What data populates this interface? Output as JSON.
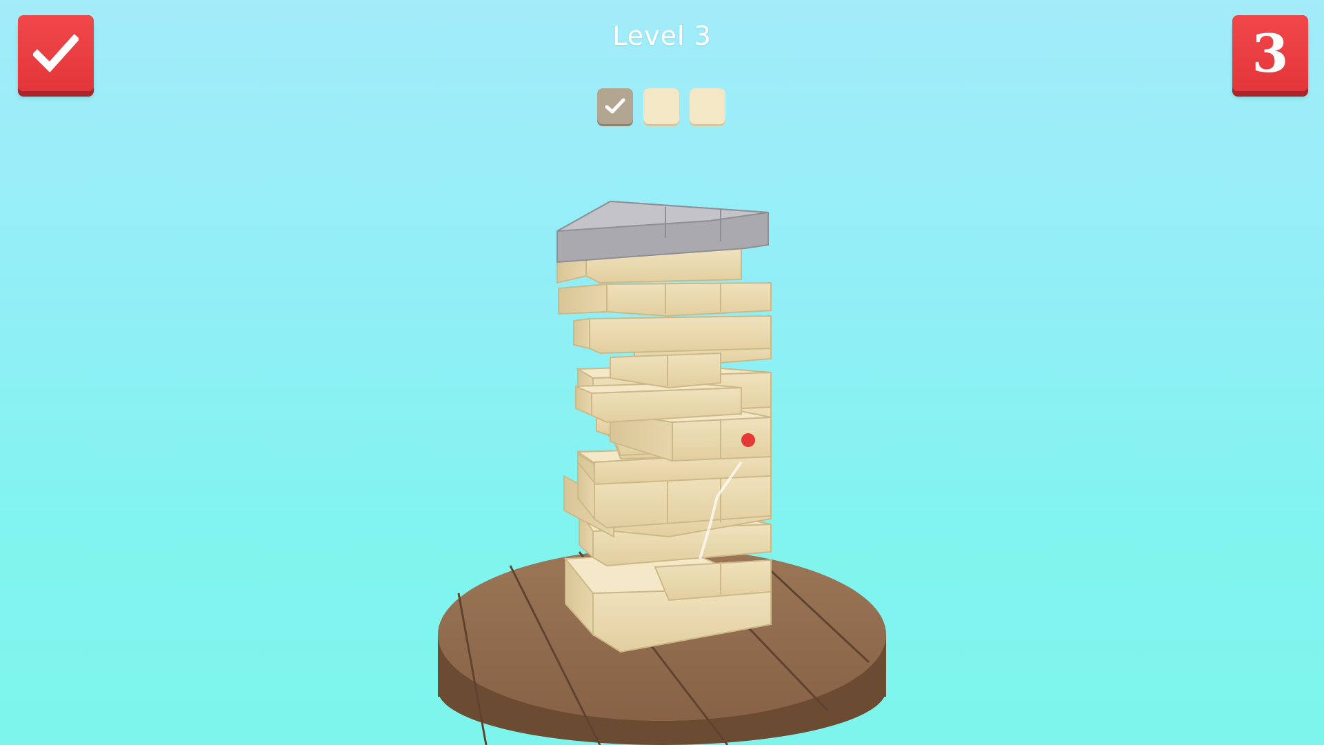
{
  "hud": {
    "check_icon": "checkmark-icon",
    "level_label": "Level 3",
    "counter_value": "3",
    "accent_color": "#e73b3e"
  },
  "progress": {
    "stages": [
      {
        "state": "completed",
        "icon": "checkmark-icon"
      },
      {
        "state": "pending"
      },
      {
        "state": "pending"
      }
    ]
  },
  "scene": {
    "tower": "wooden-block-tower",
    "top_block": "gray-stone-slab",
    "target_marker": "red-dot",
    "table": "round-wooden-table",
    "block_color": "#ead8ae",
    "table_color": "#8f6a4b",
    "sky_color": "#93eef7"
  }
}
